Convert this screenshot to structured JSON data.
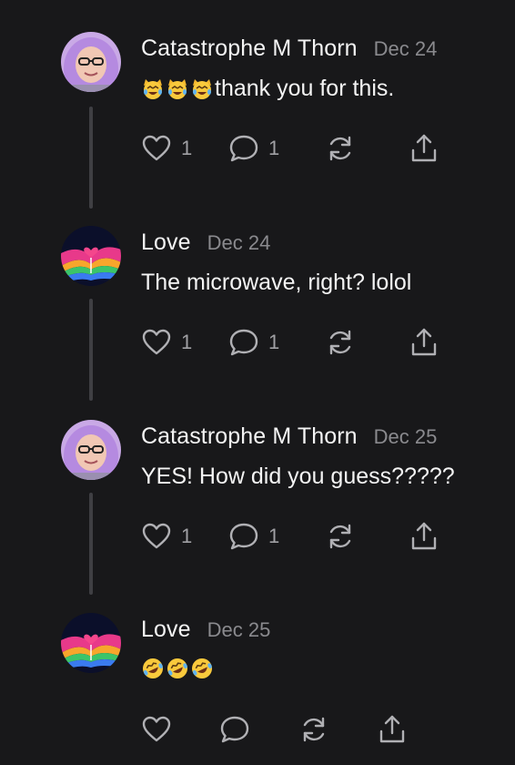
{
  "posts": [
    {
      "author": "Catastrophe M Thorn",
      "date": "Dec 24",
      "text": "thank you for this.",
      "emojis": [
        "crying-laughing-cat",
        "crying-laughing-cat",
        "crying-laughing-cat"
      ],
      "avatar": "woman-purple-hood",
      "likes": "1",
      "replies": "1"
    },
    {
      "author": "Love",
      "date": "Dec 24",
      "text": "The microwave, right? lolol",
      "emojis": [],
      "avatar": "rainbow-heart-art",
      "likes": "1",
      "replies": "1"
    },
    {
      "author": "Catastrophe M Thorn",
      "date": "Dec 25",
      "text": "YES! How did you guess?????",
      "emojis": [],
      "avatar": "woman-purple-hood",
      "likes": "1",
      "replies": "1"
    },
    {
      "author": "Love",
      "date": "Dec 25",
      "text": "",
      "emojis": [
        "rolling-on-floor-laughing",
        "rolling-on-floor-laughing",
        "rolling-on-floor-laughing"
      ],
      "avatar": "rainbow-heart-art",
      "likes": "",
      "replies": ""
    }
  ],
  "icons": {
    "like": "heart-icon",
    "reply": "comment-icon",
    "restack": "restack-icon",
    "share": "share-icon"
  },
  "colors": {
    "background": "#18181a",
    "text": "#f4f4f4",
    "muted": "#8a8a8e",
    "icon": "#b0b0b4",
    "thread_line": "#3f3f43"
  }
}
